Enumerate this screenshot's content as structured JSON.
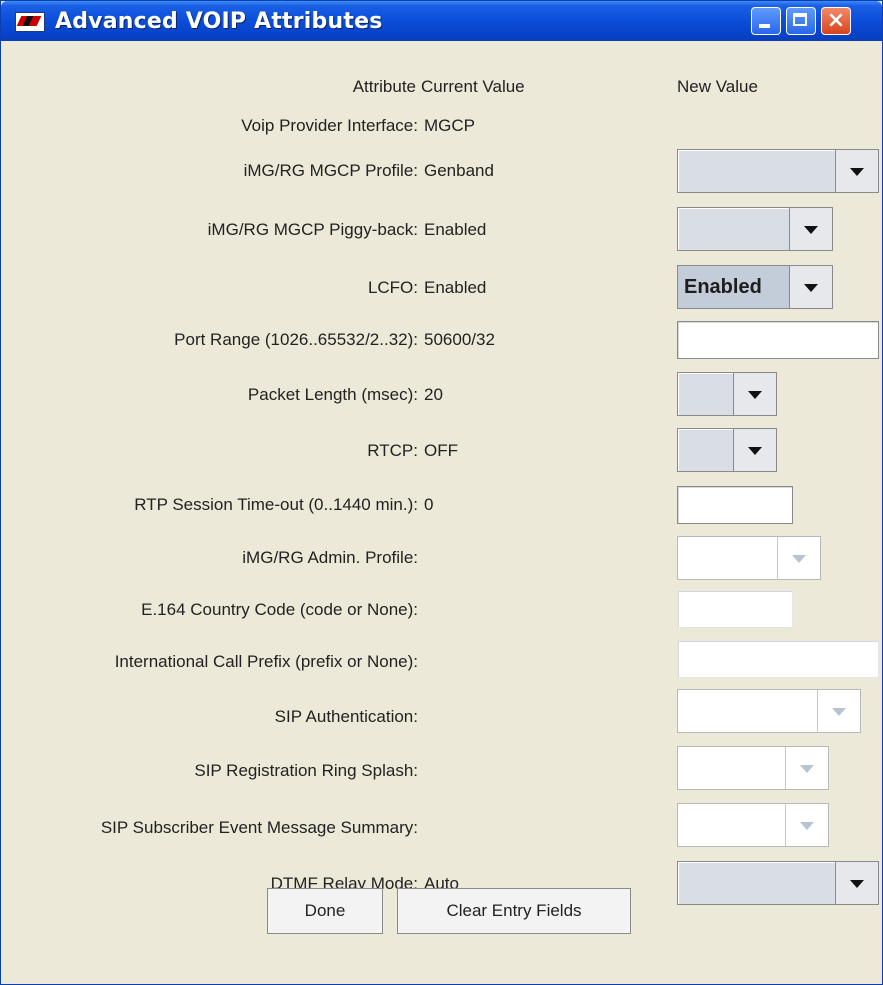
{
  "window": {
    "title": "Advanced VOIP Attributes",
    "controls": {
      "minimize": "minimize",
      "maximize": "maximize",
      "close": "×"
    }
  },
  "headers": {
    "attribute": "Attribute",
    "current": "Current Value",
    "new": "New Value"
  },
  "rows": [
    {
      "label": "Voip Provider Interface:",
      "current": "MGCP"
    },
    {
      "label": "iMG/RG MGCP Profile:",
      "current": "Genband"
    },
    {
      "label": "iMG/RG MGCP Piggy-back:",
      "current": "Enabled"
    },
    {
      "label": "LCFO:",
      "current": "Enabled",
      "new_value": "Enabled"
    },
    {
      "label": "Port Range (1026..65532/2..32):",
      "current": "50600/32"
    },
    {
      "label": "Packet Length (msec):",
      "current": "20"
    },
    {
      "label": "RTCP:",
      "current": "OFF"
    },
    {
      "label": "RTP Session Time-out (0..1440 min.):",
      "current": "0"
    },
    {
      "label": "iMG/RG Admin. Profile:",
      "current": ""
    },
    {
      "label": "E.164 Country Code (code or None):",
      "current": ""
    },
    {
      "label": "International Call Prefix (prefix or None):",
      "current": ""
    },
    {
      "label": "SIP Authentication:",
      "current": ""
    },
    {
      "label": "SIP Registration Ring Splash:",
      "current": ""
    },
    {
      "label": "SIP Subscriber Event Message Summary:",
      "current": ""
    },
    {
      "label": "DTMF Relay Mode:",
      "current": "Auto"
    }
  ],
  "buttons": {
    "done": "Done",
    "clear": "Clear Entry Fields"
  }
}
